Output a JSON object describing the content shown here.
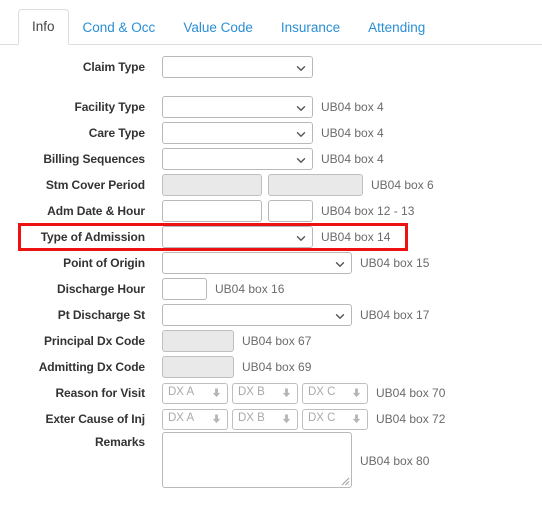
{
  "tabs": [
    {
      "label": "Info",
      "active": true
    },
    {
      "label": "Cond & Occ",
      "active": false
    },
    {
      "label": "Value Code",
      "active": false
    },
    {
      "label": "Insurance",
      "active": false
    },
    {
      "label": "Attending",
      "active": false
    }
  ],
  "form": {
    "claim_type": {
      "label": "Claim Type",
      "value": "",
      "hint": ""
    },
    "facility_type": {
      "label": "Facility Type",
      "value": "",
      "hint": "UB04 box 4"
    },
    "care_type": {
      "label": "Care Type",
      "value": "",
      "hint": "UB04 box 4"
    },
    "billing_sequences": {
      "label": "Billing Sequences",
      "value": "",
      "hint": "UB04 box 4"
    },
    "stm_cover_period": {
      "label": "Stm Cover Period",
      "value_from": "",
      "value_to": "",
      "hint": "UB04 box 6"
    },
    "adm_date_hour": {
      "label": "Adm Date & Hour",
      "value_date": "",
      "value_hour": "",
      "hint": "UB04 box 12 - 13"
    },
    "type_of_admission": {
      "label": "Type of Admission",
      "value": "",
      "hint": "UB04 box 14",
      "highlighted": true
    },
    "point_of_origin": {
      "label": "Point of Origin",
      "value": "",
      "hint": "UB04 box 15"
    },
    "discharge_hour": {
      "label": "Discharge Hour",
      "value": "",
      "hint": "UB04 box 16"
    },
    "pt_discharge_st": {
      "label": "Pt Discharge St",
      "value": "",
      "hint": "UB04 box 17"
    },
    "principal_dx_code": {
      "label": "Principal Dx Code",
      "value": "",
      "hint": "UB04 box 67"
    },
    "admitting_dx_code": {
      "label": "Admitting Dx Code",
      "value": "",
      "hint": "UB04 box 69"
    },
    "reason_for_visit": {
      "label": "Reason for Visit",
      "hint": "UB04 box 70",
      "selects": [
        {
          "placeholder": "DX A"
        },
        {
          "placeholder": "DX B"
        },
        {
          "placeholder": "DX C"
        }
      ]
    },
    "exter_cause_of_inj": {
      "label": "Exter Cause of Inj",
      "hint": "UB04 box 72",
      "selects": [
        {
          "placeholder": "DX A"
        },
        {
          "placeholder": "DX B"
        },
        {
          "placeholder": "DX C"
        }
      ]
    },
    "remarks": {
      "label": "Remarks",
      "value": "",
      "hint": "UB04 box 80"
    }
  },
  "colors": {
    "tab_link": "#2b8fd4",
    "highlight": "#ee1111",
    "hint_text": "#6b6b6b",
    "label_text": "#333333",
    "disabled_field": "#e9e9e9"
  }
}
